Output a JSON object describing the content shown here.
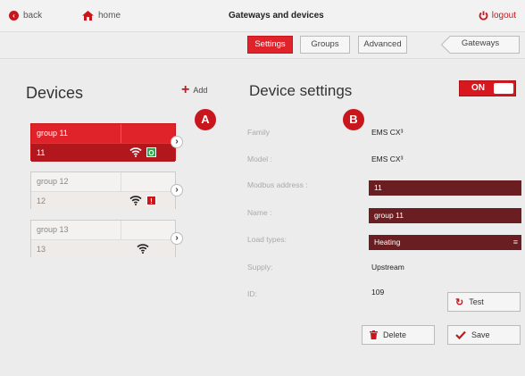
{
  "header": {
    "back_label": "back",
    "home_label": "home",
    "title": "Gateways and devices",
    "logout_label": "logout"
  },
  "tabs": {
    "settings": "Settings",
    "groups": "Groups",
    "advanced": "Advanced",
    "gateways": "Gateways",
    "active": "Settings"
  },
  "devices": {
    "title": "Devices",
    "add_label": "Add",
    "items": [
      {
        "group": "group 11",
        "id": "11",
        "status": "ok",
        "status_glyph": "O",
        "selected": true
      },
      {
        "group": "group 12",
        "id": "12",
        "status": "error",
        "status_glyph": "!",
        "selected": false
      },
      {
        "group": "group 13",
        "id": "13",
        "status": "none",
        "status_glyph": "",
        "selected": false
      }
    ]
  },
  "markers": {
    "a": "A",
    "b": "B"
  },
  "settings": {
    "title": "Device settings",
    "toggle_label": "ON",
    "family_label": "Family",
    "family_value": "EMS CX³",
    "model_label": "Model :",
    "model_value": "EMS CX³",
    "modbus_label": "Modbus address :",
    "modbus_value": "11",
    "name_label": "Name :",
    "name_value": "group 11",
    "load_label": "Load types:",
    "load_value": "Heating",
    "supply_label": "Supply:",
    "supply_value": "Upstream",
    "id_label": "ID:",
    "id_value": "109",
    "test_label": "Test",
    "delete_label": "Delete",
    "save_label": "Save"
  },
  "colors": {
    "accent": "#e0222a",
    "dark_field": "#6b1e22",
    "ok": "#2ba84a"
  },
  "icons": [
    "back-arrow-icon",
    "home-icon",
    "power-icon",
    "plus-icon",
    "wifi-icon",
    "chevron-right-icon",
    "refresh-icon",
    "trash-icon",
    "checkmark-icon",
    "menu-icon"
  ]
}
